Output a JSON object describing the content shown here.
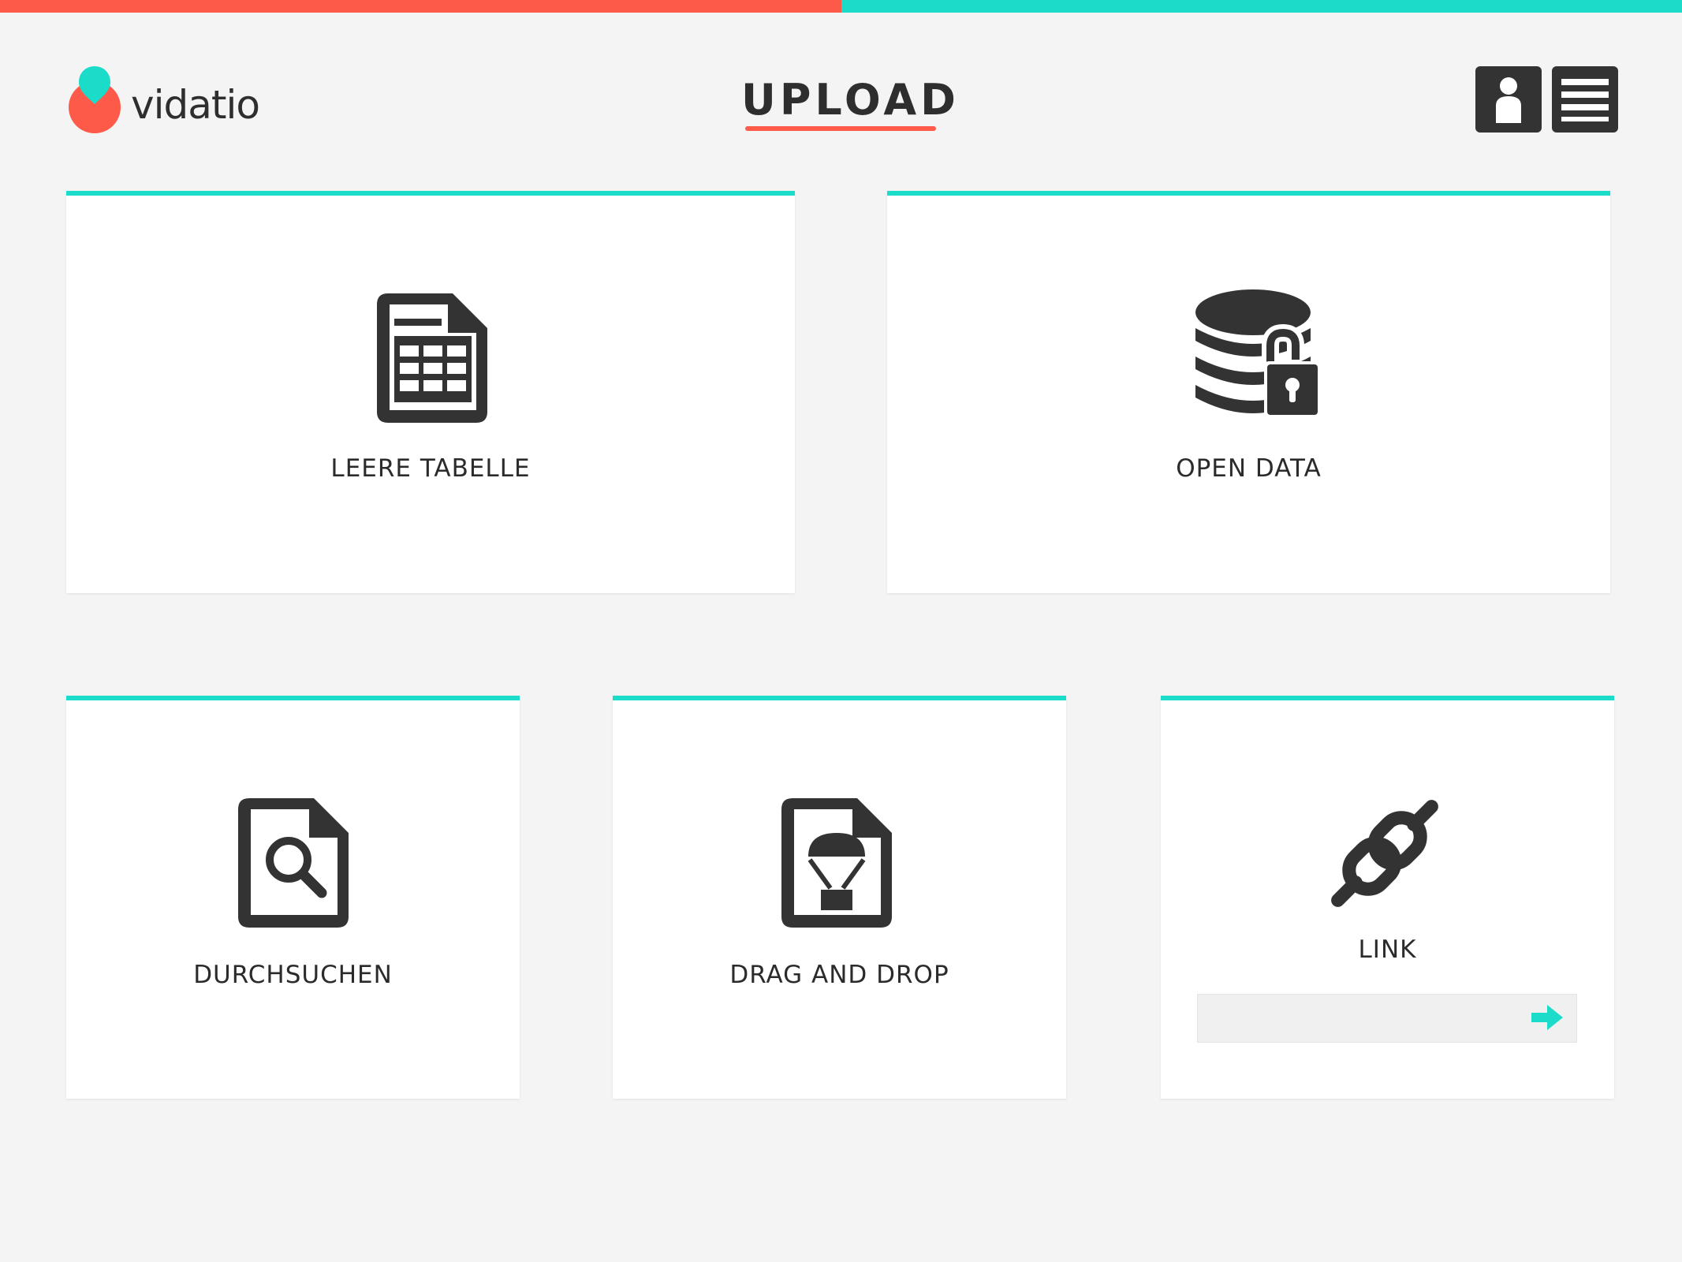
{
  "app": {
    "name": "vidatio"
  },
  "progress": {
    "fraction": 0.5
  },
  "header": {
    "title": "UPLOAD",
    "profile_icon": "user-icon",
    "menu_icon": "hamburger-menu-icon"
  },
  "options": [
    {
      "label": "LEERE TABELLE",
      "icon": "spreadsheet-file-icon"
    },
    {
      "label": "OPEN DATA",
      "icon": "database-unlock-icon"
    },
    {
      "label": "DURCHSUCHEN",
      "icon": "file-search-icon"
    },
    {
      "label": "DRAG AND DROP",
      "icon": "file-parachute-icon"
    },
    {
      "label": "LINK",
      "icon": "chain-link-icon"
    }
  ],
  "link_input": {
    "value": "",
    "placeholder": "",
    "submit_icon": "arrow-right-icon"
  },
  "colors": {
    "accent": "#1adcc8",
    "brand": "#fe5a4a",
    "background": "#f4f4f4",
    "dark": "#333333"
  }
}
